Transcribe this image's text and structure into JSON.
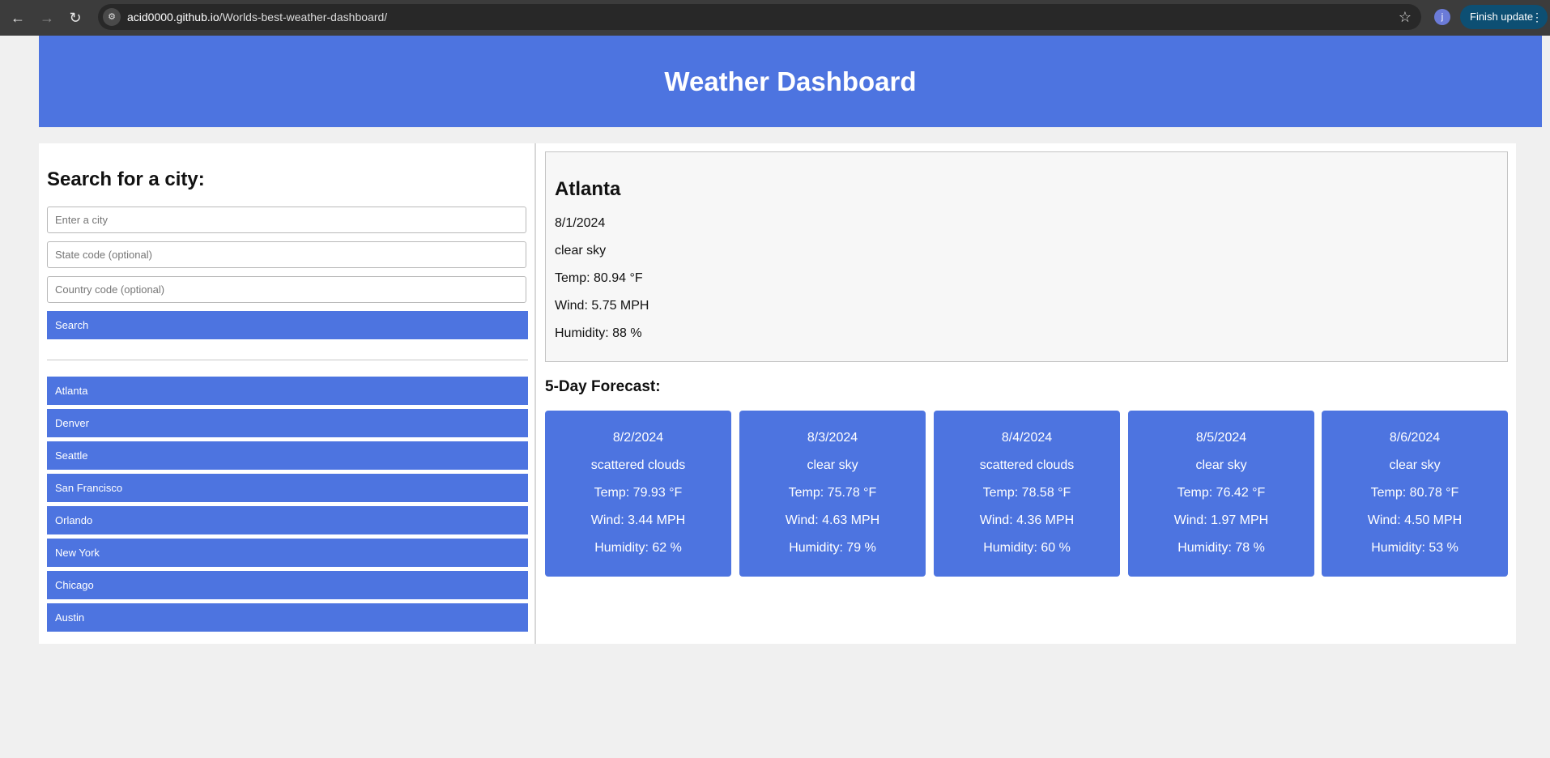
{
  "browser": {
    "url_host": "acid0000.github.io",
    "url_path": "/Worlds-best-weather-dashboard/",
    "profile_initial": "j",
    "update_label": "Finish update"
  },
  "header": {
    "title": "Weather Dashboard"
  },
  "sidebar": {
    "heading": "Search for a city:",
    "city_placeholder": "Enter a city",
    "state_placeholder": "State code (optional)",
    "country_placeholder": "Country code (optional)",
    "search_label": "Search",
    "history": [
      "Atlanta",
      "Denver",
      "Seattle",
      "San Francisco",
      "Orlando",
      "New York",
      "Chicago",
      "Austin"
    ]
  },
  "current": {
    "city": "Atlanta",
    "date": "8/1/2024",
    "description": "clear sky",
    "temp": "Temp: 80.94 °F",
    "wind": "Wind: 5.75 MPH",
    "humidity": "Humidity: 88 %"
  },
  "forecast": {
    "title": "5-Day Forecast:",
    "days": [
      {
        "date": "8/2/2024",
        "description": "scattered clouds",
        "temp": "Temp: 79.93 °F",
        "wind": "Wind: 3.44 MPH",
        "humidity": "Humidity: 62 %"
      },
      {
        "date": "8/3/2024",
        "description": "clear sky",
        "temp": "Temp: 75.78 °F",
        "wind": "Wind: 4.63 MPH",
        "humidity": "Humidity: 79 %"
      },
      {
        "date": "8/4/2024",
        "description": "scattered clouds",
        "temp": "Temp: 78.58 °F",
        "wind": "Wind: 4.36 MPH",
        "humidity": "Humidity: 60 %"
      },
      {
        "date": "8/5/2024",
        "description": "clear sky",
        "temp": "Temp: 76.42 °F",
        "wind": "Wind: 1.97 MPH",
        "humidity": "Humidity: 78 %"
      },
      {
        "date": "8/6/2024",
        "description": "clear sky",
        "temp": "Temp: 80.78 °F",
        "wind": "Wind: 4.50 MPH",
        "humidity": "Humidity: 53 %"
      }
    ]
  }
}
